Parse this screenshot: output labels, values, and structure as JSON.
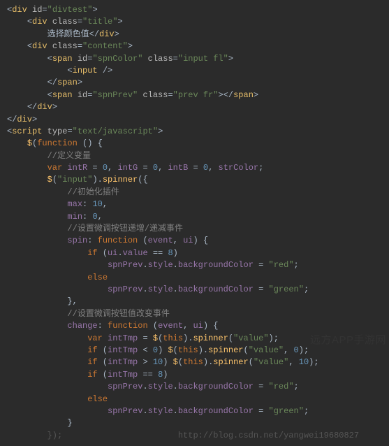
{
  "code": {
    "lines": [
      {
        "cls": "",
        "indent": 0,
        "segments": [
          {
            "cls": "punct",
            "t": "<"
          },
          {
            "cls": "tag",
            "t": "div"
          },
          {
            "cls": "punct",
            "t": " "
          },
          {
            "cls": "attr",
            "t": "id"
          },
          {
            "cls": "punct",
            "t": "="
          },
          {
            "cls": "str",
            "t": "\"divtest\""
          },
          {
            "cls": "punct",
            "t": ">"
          }
        ]
      },
      {
        "cls": "",
        "indent": 1,
        "segments": [
          {
            "cls": "punct",
            "t": "<"
          },
          {
            "cls": "tag",
            "t": "div"
          },
          {
            "cls": "punct",
            "t": " "
          },
          {
            "cls": "attr",
            "t": "class"
          },
          {
            "cls": "punct",
            "t": "="
          },
          {
            "cls": "str",
            "t": "\"title\""
          },
          {
            "cls": "punct",
            "t": ">"
          }
        ]
      },
      {
        "cls": "",
        "indent": 2,
        "segments": [
          {
            "cls": "txt",
            "t": "选择颜色值"
          },
          {
            "cls": "punct",
            "t": "</"
          },
          {
            "cls": "tag",
            "t": "div"
          },
          {
            "cls": "punct",
            "t": ">"
          }
        ]
      },
      {
        "cls": "",
        "indent": 1,
        "segments": [
          {
            "cls": "punct",
            "t": "<"
          },
          {
            "cls": "tag",
            "t": "div"
          },
          {
            "cls": "punct",
            "t": " "
          },
          {
            "cls": "attr",
            "t": "class"
          },
          {
            "cls": "punct",
            "t": "="
          },
          {
            "cls": "str",
            "t": "\"content\""
          },
          {
            "cls": "punct",
            "t": ">"
          }
        ]
      },
      {
        "cls": "",
        "indent": 2,
        "segments": [
          {
            "cls": "punct",
            "t": "<"
          },
          {
            "cls": "tag",
            "t": "span"
          },
          {
            "cls": "punct",
            "t": " "
          },
          {
            "cls": "attr",
            "t": "id"
          },
          {
            "cls": "punct",
            "t": "="
          },
          {
            "cls": "str",
            "t": "\"spnColor\""
          },
          {
            "cls": "punct",
            "t": " "
          },
          {
            "cls": "attr",
            "t": "class"
          },
          {
            "cls": "punct",
            "t": "="
          },
          {
            "cls": "str",
            "t": "\"input fl\""
          },
          {
            "cls": "punct",
            "t": ">"
          }
        ]
      },
      {
        "cls": "",
        "indent": 3,
        "segments": [
          {
            "cls": "punct",
            "t": "<"
          },
          {
            "cls": "tag",
            "t": "input"
          },
          {
            "cls": "punct",
            "t": " />"
          }
        ]
      },
      {
        "cls": "",
        "indent": 2,
        "segments": [
          {
            "cls": "punct",
            "t": "</"
          },
          {
            "cls": "tag",
            "t": "span"
          },
          {
            "cls": "punct",
            "t": ">"
          }
        ]
      },
      {
        "cls": "",
        "indent": 2,
        "segments": [
          {
            "cls": "punct",
            "t": "<"
          },
          {
            "cls": "tag",
            "t": "span"
          },
          {
            "cls": "punct",
            "t": " "
          },
          {
            "cls": "attr",
            "t": "id"
          },
          {
            "cls": "punct",
            "t": "="
          },
          {
            "cls": "str",
            "t": "\"spnPrev\""
          },
          {
            "cls": "punct",
            "t": " "
          },
          {
            "cls": "attr",
            "t": "class"
          },
          {
            "cls": "punct",
            "t": "="
          },
          {
            "cls": "str",
            "t": "\"prev fr\""
          },
          {
            "cls": "punct",
            "t": "></"
          },
          {
            "cls": "tag",
            "t": "span"
          },
          {
            "cls": "punct",
            "t": ">"
          }
        ]
      },
      {
        "cls": "",
        "indent": 1,
        "segments": [
          {
            "cls": "punct",
            "t": "</"
          },
          {
            "cls": "tag",
            "t": "div"
          },
          {
            "cls": "punct",
            "t": ">"
          }
        ]
      },
      {
        "cls": "",
        "indent": 0,
        "segments": [
          {
            "cls": "punct",
            "t": "</"
          },
          {
            "cls": "tag",
            "t": "div"
          },
          {
            "cls": "punct",
            "t": ">"
          }
        ]
      },
      {
        "cls": "",
        "indent": 0,
        "segments": [
          {
            "cls": "punct",
            "t": "<"
          },
          {
            "cls": "tag",
            "t": "script"
          },
          {
            "cls": "punct",
            "t": " "
          },
          {
            "cls": "attr",
            "t": "type"
          },
          {
            "cls": "punct",
            "t": "="
          },
          {
            "cls": "str",
            "t": "\"text/javascript\""
          },
          {
            "cls": "punct",
            "t": ">"
          }
        ]
      },
      {
        "cls": "",
        "indent": 1,
        "segments": [
          {
            "cls": "fn",
            "t": "$"
          },
          {
            "cls": "punct",
            "t": "("
          },
          {
            "cls": "kw",
            "t": "function"
          },
          {
            "cls": "punct",
            "t": " () {"
          }
        ]
      },
      {
        "cls": "",
        "indent": 2,
        "segments": [
          {
            "cls": "cmt",
            "t": "//定义变量"
          }
        ]
      },
      {
        "cls": "",
        "indent": 2,
        "segments": [
          {
            "cls": "kw",
            "t": "var "
          },
          {
            "cls": "id",
            "t": "intR"
          },
          {
            "cls": "punct",
            "t": " = "
          },
          {
            "cls": "num",
            "t": "0"
          },
          {
            "cls": "punct",
            "t": ", "
          },
          {
            "cls": "id",
            "t": "intG"
          },
          {
            "cls": "punct",
            "t": " = "
          },
          {
            "cls": "num",
            "t": "0"
          },
          {
            "cls": "punct",
            "t": ", "
          },
          {
            "cls": "id",
            "t": "intB"
          },
          {
            "cls": "punct",
            "t": " = "
          },
          {
            "cls": "num",
            "t": "0"
          },
          {
            "cls": "punct",
            "t": ", "
          },
          {
            "cls": "id",
            "t": "strColor"
          },
          {
            "cls": "punct",
            "t": ";"
          }
        ]
      },
      {
        "cls": "",
        "indent": 2,
        "segments": [
          {
            "cls": "fn",
            "t": "$"
          },
          {
            "cls": "punct",
            "t": "("
          },
          {
            "cls": "str",
            "t": "\"input\""
          },
          {
            "cls": "punct",
            "t": ")."
          },
          {
            "cls": "fn",
            "t": "spinner"
          },
          {
            "cls": "punct",
            "t": "({"
          }
        ]
      },
      {
        "cls": "",
        "indent": 3,
        "segments": [
          {
            "cls": "cmt",
            "t": "//初始化插件"
          }
        ]
      },
      {
        "cls": "",
        "indent": 3,
        "segments": [
          {
            "cls": "id",
            "t": "max"
          },
          {
            "cls": "punct",
            "t": ": "
          },
          {
            "cls": "num",
            "t": "10"
          },
          {
            "cls": "punct",
            "t": ","
          }
        ]
      },
      {
        "cls": "",
        "indent": 3,
        "segments": [
          {
            "cls": "id",
            "t": "min"
          },
          {
            "cls": "punct",
            "t": ": "
          },
          {
            "cls": "num",
            "t": "0"
          },
          {
            "cls": "punct",
            "t": ","
          }
        ]
      },
      {
        "cls": "",
        "indent": 3,
        "segments": [
          {
            "cls": "cmt",
            "t": "//设置微调按钮递增/递减事件"
          }
        ]
      },
      {
        "cls": "",
        "indent": 3,
        "segments": [
          {
            "cls": "id",
            "t": "spin"
          },
          {
            "cls": "punct",
            "t": ": "
          },
          {
            "cls": "kw",
            "t": "function"
          },
          {
            "cls": "punct",
            "t": " ("
          },
          {
            "cls": "id",
            "t": "event"
          },
          {
            "cls": "punct",
            "t": ", "
          },
          {
            "cls": "id",
            "t": "ui"
          },
          {
            "cls": "punct",
            "t": ") {"
          }
        ]
      },
      {
        "cls": "",
        "indent": 4,
        "segments": [
          {
            "cls": "kw",
            "t": "if"
          },
          {
            "cls": "punct",
            "t": " ("
          },
          {
            "cls": "id",
            "t": "ui"
          },
          {
            "cls": "punct",
            "t": "."
          },
          {
            "cls": "id",
            "t": "value"
          },
          {
            "cls": "punct",
            "t": " == "
          },
          {
            "cls": "num",
            "t": "8"
          },
          {
            "cls": "punct",
            "t": ")"
          }
        ]
      },
      {
        "cls": "",
        "indent": 5,
        "segments": [
          {
            "cls": "id",
            "t": "spnPrev"
          },
          {
            "cls": "punct",
            "t": "."
          },
          {
            "cls": "id",
            "t": "style"
          },
          {
            "cls": "punct",
            "t": "."
          },
          {
            "cls": "id",
            "t": "backgroundColor"
          },
          {
            "cls": "punct",
            "t": " = "
          },
          {
            "cls": "str",
            "t": "\"red\""
          },
          {
            "cls": "punct",
            "t": ";"
          }
        ]
      },
      {
        "cls": "",
        "indent": 4,
        "segments": [
          {
            "cls": "kw",
            "t": "else"
          }
        ]
      },
      {
        "cls": "",
        "indent": 5,
        "segments": [
          {
            "cls": "id",
            "t": "spnPrev"
          },
          {
            "cls": "punct",
            "t": "."
          },
          {
            "cls": "id",
            "t": "style"
          },
          {
            "cls": "punct",
            "t": "."
          },
          {
            "cls": "id",
            "t": "backgroundColor"
          },
          {
            "cls": "punct",
            "t": " = "
          },
          {
            "cls": "str",
            "t": "\"green\""
          },
          {
            "cls": "punct",
            "t": ";"
          }
        ]
      },
      {
        "cls": "",
        "indent": 3,
        "segments": [
          {
            "cls": "punct",
            "t": "},"
          }
        ]
      },
      {
        "cls": "",
        "indent": 3,
        "segments": [
          {
            "cls": "cmt",
            "t": "//设置微调按钮值改变事件"
          }
        ]
      },
      {
        "cls": "",
        "indent": 3,
        "segments": [
          {
            "cls": "id",
            "t": "change"
          },
          {
            "cls": "punct",
            "t": ": "
          },
          {
            "cls": "kw",
            "t": "function"
          },
          {
            "cls": "punct",
            "t": " ("
          },
          {
            "cls": "id",
            "t": "event"
          },
          {
            "cls": "punct",
            "t": ", "
          },
          {
            "cls": "id",
            "t": "ui"
          },
          {
            "cls": "punct",
            "t": ") {"
          }
        ]
      },
      {
        "cls": "",
        "indent": 4,
        "segments": [
          {
            "cls": "kw",
            "t": "var "
          },
          {
            "cls": "id",
            "t": "intTmp"
          },
          {
            "cls": "punct",
            "t": " = "
          },
          {
            "cls": "fn",
            "t": "$"
          },
          {
            "cls": "punct",
            "t": "("
          },
          {
            "cls": "kw",
            "t": "this"
          },
          {
            "cls": "punct",
            "t": ")."
          },
          {
            "cls": "fn",
            "t": "spinner"
          },
          {
            "cls": "punct",
            "t": "("
          },
          {
            "cls": "str",
            "t": "\"value\""
          },
          {
            "cls": "punct",
            "t": ");"
          }
        ]
      },
      {
        "cls": "",
        "indent": 4,
        "segments": [
          {
            "cls": "kw",
            "t": "if"
          },
          {
            "cls": "punct",
            "t": " ("
          },
          {
            "cls": "id",
            "t": "intTmp"
          },
          {
            "cls": "punct",
            "t": " < "
          },
          {
            "cls": "num",
            "t": "0"
          },
          {
            "cls": "punct",
            "t": ") "
          },
          {
            "cls": "fn",
            "t": "$"
          },
          {
            "cls": "punct",
            "t": "("
          },
          {
            "cls": "kw",
            "t": "this"
          },
          {
            "cls": "punct",
            "t": ")."
          },
          {
            "cls": "fn",
            "t": "spinner"
          },
          {
            "cls": "punct",
            "t": "("
          },
          {
            "cls": "str",
            "t": "\"value\""
          },
          {
            "cls": "punct",
            "t": ", "
          },
          {
            "cls": "num",
            "t": "0"
          },
          {
            "cls": "punct",
            "t": ");"
          }
        ]
      },
      {
        "cls": "",
        "indent": 4,
        "segments": [
          {
            "cls": "kw",
            "t": "if"
          },
          {
            "cls": "punct",
            "t": " ("
          },
          {
            "cls": "id",
            "t": "intTmp"
          },
          {
            "cls": "punct",
            "t": " > "
          },
          {
            "cls": "num",
            "t": "10"
          },
          {
            "cls": "punct",
            "t": ") "
          },
          {
            "cls": "fn",
            "t": "$"
          },
          {
            "cls": "punct",
            "t": "("
          },
          {
            "cls": "kw",
            "t": "this"
          },
          {
            "cls": "punct",
            "t": ")."
          },
          {
            "cls": "fn",
            "t": "spinner"
          },
          {
            "cls": "punct",
            "t": "("
          },
          {
            "cls": "str",
            "t": "\"value\""
          },
          {
            "cls": "punct",
            "t": ", "
          },
          {
            "cls": "num",
            "t": "10"
          },
          {
            "cls": "punct",
            "t": ");"
          }
        ]
      },
      {
        "cls": "",
        "indent": 4,
        "segments": [
          {
            "cls": "kw",
            "t": "if"
          },
          {
            "cls": "punct",
            "t": " ("
          },
          {
            "cls": "id",
            "t": "intTmp"
          },
          {
            "cls": "punct",
            "t": " == "
          },
          {
            "cls": "num",
            "t": "8"
          },
          {
            "cls": "punct",
            "t": ")"
          }
        ]
      },
      {
        "cls": "",
        "indent": 5,
        "segments": [
          {
            "cls": "id",
            "t": "spnPrev"
          },
          {
            "cls": "punct",
            "t": "."
          },
          {
            "cls": "id",
            "t": "style"
          },
          {
            "cls": "punct",
            "t": "."
          },
          {
            "cls": "id",
            "t": "backgroundColor"
          },
          {
            "cls": "punct",
            "t": " = "
          },
          {
            "cls": "str",
            "t": "\"red\""
          },
          {
            "cls": "punct",
            "t": ";"
          }
        ]
      },
      {
        "cls": "",
        "indent": 4,
        "segments": [
          {
            "cls": "kw",
            "t": "else"
          }
        ]
      },
      {
        "cls": "",
        "indent": 5,
        "segments": [
          {
            "cls": "id",
            "t": "spnPrev"
          },
          {
            "cls": "punct",
            "t": "."
          },
          {
            "cls": "id",
            "t": "style"
          },
          {
            "cls": "punct",
            "t": "."
          },
          {
            "cls": "id",
            "t": "backgroundColor"
          },
          {
            "cls": "punct",
            "t": " = "
          },
          {
            "cls": "str",
            "t": "\"green\""
          },
          {
            "cls": "punct",
            "t": ";"
          }
        ]
      },
      {
        "cls": "",
        "indent": 3,
        "segments": [
          {
            "cls": "punct",
            "t": "}"
          }
        ]
      },
      {
        "cls": "",
        "indent": 0,
        "segments": [
          {
            "cls": "mute",
            "t": "        });                       http://blog.csdn.net/yangwei19680827"
          }
        ]
      }
    ]
  },
  "watermark": {
    "main": "远方APP手游网",
    "sub": ""
  }
}
